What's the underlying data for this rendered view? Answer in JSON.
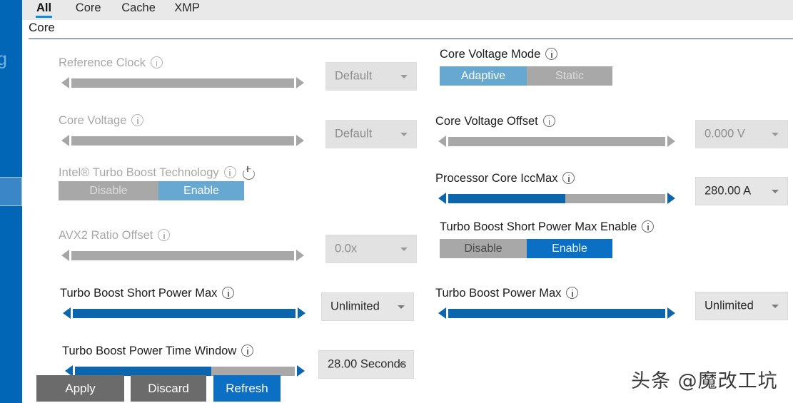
{
  "tabs": [
    {
      "label": "All",
      "active": true
    },
    {
      "label": "Core",
      "active": false
    },
    {
      "label": "Cache",
      "active": false
    },
    {
      "label": "XMP",
      "active": false
    }
  ],
  "section": {
    "title": "Core"
  },
  "sidebar": {
    "partial_glyph": "g"
  },
  "left_column": [
    {
      "label": "Reference Clock",
      "enabled": false,
      "info_icon": "info-icon",
      "slider": {
        "fill_percent": 0,
        "enabled": false
      },
      "dropdown": {
        "value": "Default",
        "enabled": false
      }
    },
    {
      "label": "Core Voltage",
      "enabled": false,
      "info_icon": "info-icon",
      "slider": {
        "fill_percent": 0,
        "enabled": false
      },
      "dropdown": {
        "value": "Default",
        "enabled": false
      }
    },
    {
      "label": "Intel® Turbo Boost Technology",
      "enabled": false,
      "info_icon": "info-icon",
      "power_icon": "power-icon",
      "toggle": {
        "options": [
          "Disable",
          "Enable"
        ],
        "selected": "Enable",
        "enabled": false
      }
    },
    {
      "label": "AVX2 Ratio Offset",
      "enabled": false,
      "info_icon": "info-icon",
      "slider": {
        "fill_percent": 0,
        "enabled": false
      },
      "dropdown": {
        "value": "0.0x",
        "enabled": false
      }
    },
    {
      "label": "Turbo Boost Short Power Max",
      "enabled": true,
      "info_icon": "info-icon",
      "slider": {
        "fill_percent": 100,
        "enabled": true
      },
      "dropdown": {
        "value": "Unlimited",
        "enabled": true
      }
    },
    {
      "label": "Turbo Boost Power Time Window",
      "enabled": true,
      "info_icon": "info-icon",
      "slider": {
        "fill_percent": 62,
        "enabled": true
      },
      "dropdown": {
        "value": "28.00 Seconds",
        "enabled": true
      }
    }
  ],
  "right_column": [
    {
      "label": "Core Voltage Mode",
      "enabled": true,
      "info_icon": "info-icon",
      "toggle": {
        "options": [
          "Adaptive",
          "Static"
        ],
        "selected": "Adaptive",
        "enabled": false
      }
    },
    {
      "label": "Core Voltage Offset",
      "enabled": true,
      "info_icon": "info-icon",
      "slider": {
        "fill_percent": 0,
        "enabled": false
      },
      "dropdown": {
        "value": "0.000 V",
        "enabled": false
      }
    },
    {
      "label": "Processor Core IccMax",
      "enabled": true,
      "info_icon": "info-icon",
      "slider": {
        "fill_percent": 54,
        "enabled": true
      },
      "dropdown": {
        "value": "280.00 A",
        "enabled": true
      }
    },
    {
      "label": "Turbo Boost Short Power Max Enable",
      "enabled": true,
      "info_icon": "info-icon",
      "toggle": {
        "options": [
          "Disable",
          "Enable"
        ],
        "selected": "Enable",
        "enabled": true
      }
    },
    {
      "label": "Turbo Boost Power Max",
      "enabled": true,
      "info_icon": "info-icon",
      "slider": {
        "fill_percent": 100,
        "enabled": true
      },
      "dropdown": {
        "value": "Unlimited",
        "enabled": true
      }
    }
  ],
  "footer": {
    "apply_label": "Apply",
    "discard_label": "Discard",
    "refresh_label": "Refresh"
  },
  "watermark": {
    "text": "头条 @魔改工坑"
  },
  "colors": {
    "rail_blue": "#0066b5",
    "accent_blue": "#0b66ad",
    "tab_underline": "#0f8ce0",
    "toggle_on": "#0b6fc4",
    "toggle_on_dim": "#66a8d0",
    "grey": "#a8a8a8"
  }
}
